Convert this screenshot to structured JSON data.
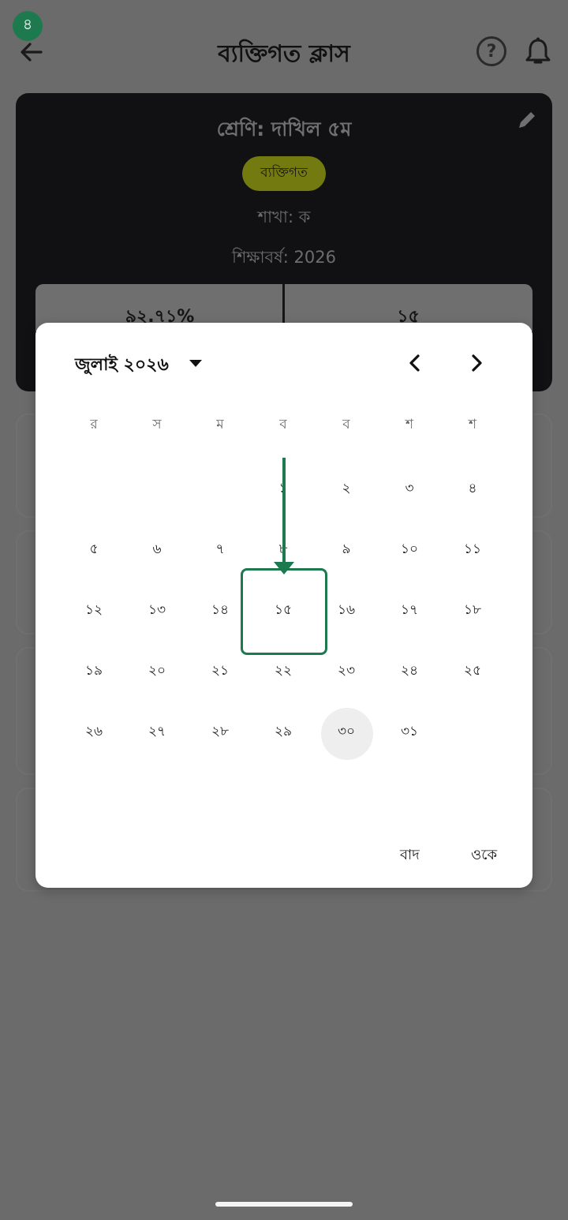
{
  "step_badge": "৪",
  "appbar": {
    "title": "ব্যক্তিগত ক্লাস",
    "help_label": "?"
  },
  "info_card": {
    "class_name": "শ্রেণি: দাখিল ৫ম",
    "type_pill": "ব্যক্তিগত",
    "section": "শাখা: ক",
    "year": "শিক্ষাবর্ষ: 2026",
    "stat_left": "৯২.৭১%",
    "stat_right": "১৫"
  },
  "datepicker": {
    "month_label": "জুলাই ২০২৬",
    "weekdays": [
      "র",
      "স",
      "ম",
      "ব",
      "ব",
      "শ",
      "শ"
    ],
    "days": [
      [
        "",
        "",
        "",
        "১",
        "২",
        "৩",
        "৪"
      ],
      [
        "৫",
        "৬",
        "৭",
        "৮",
        "৯",
        "১০",
        "১১"
      ],
      [
        "১২",
        "১৩",
        "১৪",
        "১৫",
        "১৬",
        "১৭",
        "১৮"
      ],
      [
        "১৯",
        "২০",
        "২১",
        "২২",
        "২৩",
        "২৪",
        "২৫"
      ],
      [
        "২৬",
        "২৭",
        "২৮",
        "২৯",
        "৩০",
        "৩১",
        ""
      ]
    ],
    "today": "৩০",
    "cancel_label": "বাদ",
    "ok_label": "ওকে"
  },
  "colors": {
    "accent": "#1d7a4f",
    "pill": "#737a10",
    "scrim": "#6b6b6b"
  }
}
